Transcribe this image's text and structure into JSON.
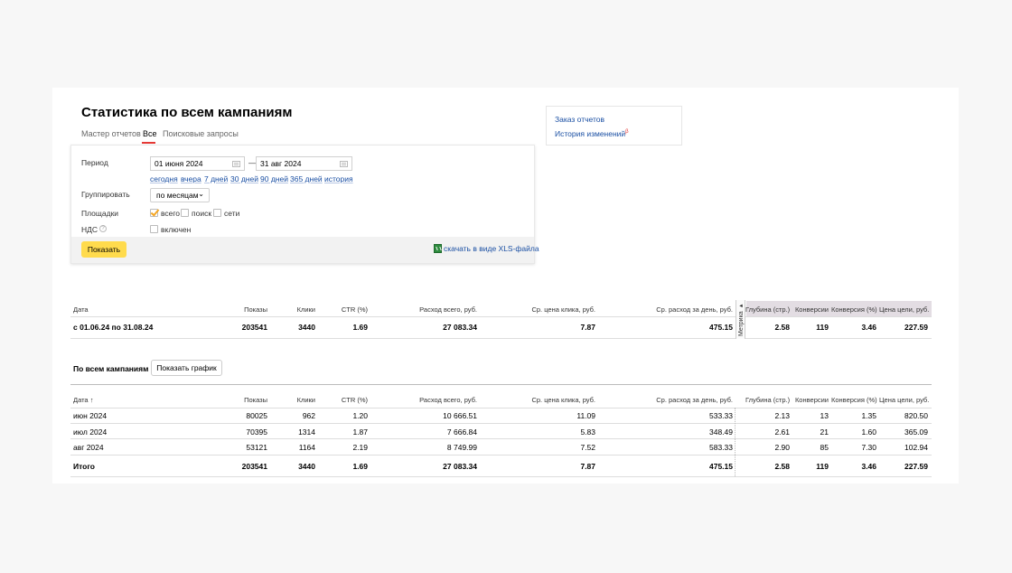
{
  "page": {
    "title": "Статистика по всем кампаниям",
    "tabs": [
      "Мастер отчетов",
      "Все",
      "Поисковые запросы"
    ],
    "active_tab": "Все"
  },
  "side_links": {
    "order_reports": "Заказ отчетов",
    "history": "История изменений",
    "history_badge": "β"
  },
  "filters": {
    "period_label": "Период",
    "date_from": "01 июня 2024",
    "date_sep": "—",
    "date_to": "31 авг 2024",
    "quick": [
      "сегодня",
      "вчера",
      "7 дней",
      "30 дней",
      "90 дней",
      "365 дней",
      "история"
    ],
    "group_label": "Группировать",
    "group_value": "по месяцам",
    "platforms_label": "Площадки",
    "platforms": [
      {
        "label": "всего",
        "checked": true
      },
      {
        "label": "поиск",
        "checked": false
      },
      {
        "label": "сети",
        "checked": false
      }
    ],
    "vat_label": "НДС",
    "vat_help": "?",
    "vat_option": "включен",
    "show_button": "Показать",
    "download_link": "скачать в виде XLS-файла"
  },
  "summary": {
    "headers": [
      "Дата",
      "Показы",
      "Клики",
      "CTR (%)",
      "Расход всего, руб.",
      "Ср. цена клика, руб.",
      "Ср. расход за день, руб.",
      "Глубина (стр.)",
      "Конверсии",
      "Конверсия (%)",
      "Цена цели, руб."
    ],
    "metrika_tag": "Метрика",
    "row": [
      "с 01.06.24 по 31.08.24",
      "203541",
      "3440",
      "1.69",
      "27 083.34",
      "7.87",
      "475.15",
      "2.58",
      "119",
      "3.46",
      "227.59"
    ]
  },
  "campaigns": {
    "section_label": "По всем кампаниям",
    "chart_button": "Показать график",
    "headers": [
      "Дата ↑",
      "Показы",
      "Клики",
      "CTR (%)",
      "Расход всего, руб.",
      "Ср. цена клика, руб.",
      "Ср. расход за день, руб.",
      "Глубина (стр.)",
      "Конверсии",
      "Конверсия (%)",
      "Цена цели, руб."
    ],
    "rows": [
      [
        "июн 2024",
        "80025",
        "962",
        "1.20",
        "10 666.51",
        "11.09",
        "533.33",
        "2.13",
        "13",
        "1.35",
        "820.50"
      ],
      [
        "июл 2024",
        "70395",
        "1314",
        "1.87",
        "7 666.84",
        "5.83",
        "348.49",
        "2.61",
        "21",
        "1.60",
        "365.09"
      ],
      [
        "авг 2024",
        "53121",
        "1164",
        "2.19",
        "8 749.99",
        "7.52",
        "583.33",
        "2.90",
        "85",
        "7.30",
        "102.94"
      ]
    ],
    "total": [
      "Итого",
      "203541",
      "3440",
      "1.69",
      "27 083.34",
      "7.87",
      "475.15",
      "2.58",
      "119",
      "3.46",
      "227.59"
    ]
  },
  "colors": {
    "accent": "#ffdb4d",
    "link": "#1a4fa3",
    "tab_underline": "#e53935",
    "metrika_header": "#e3dde3"
  }
}
